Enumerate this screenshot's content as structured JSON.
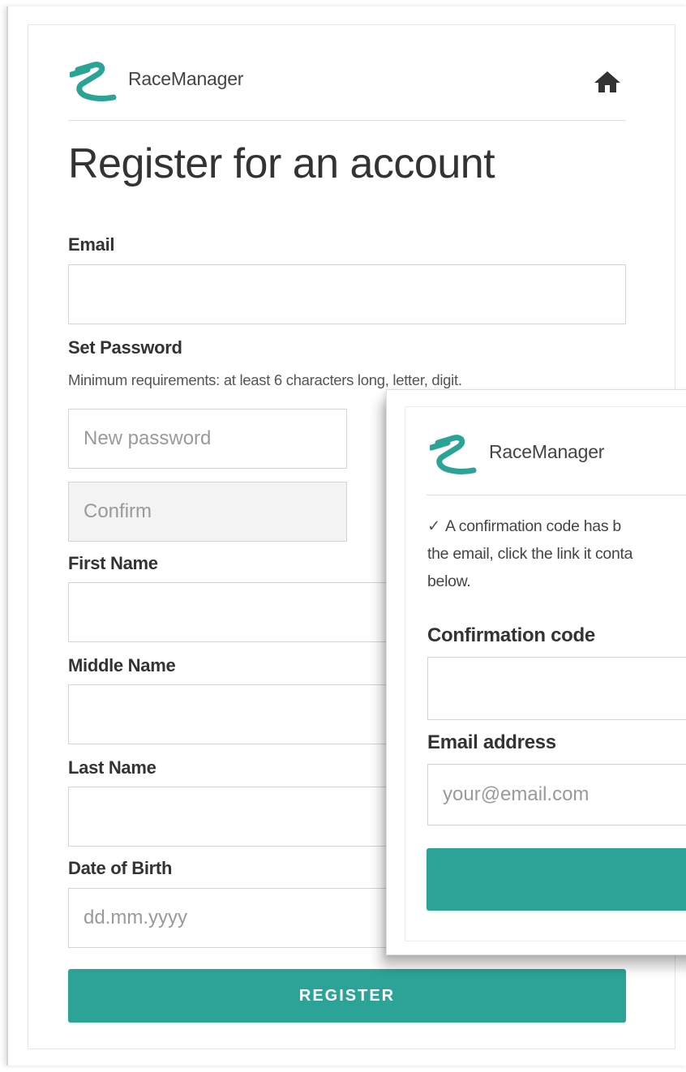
{
  "brand": {
    "name": "RaceManager",
    "accent_color": "#2ba396",
    "logo": "racemanager-r-logo"
  },
  "header": {
    "home_icon": "home-icon"
  },
  "page": {
    "title": "Register for an account"
  },
  "form": {
    "email": {
      "label": "Email",
      "value": ""
    },
    "password": {
      "label": "Set Password",
      "hint": "Minimum requirements: at least 6 characters long, letter, digit.",
      "new_placeholder": "New password",
      "confirm_placeholder": "Confirm"
    },
    "first_name": {
      "label": "First Name",
      "value": ""
    },
    "middle_name": {
      "label": "Middle Name",
      "value": ""
    },
    "last_name": {
      "label": "Last Name",
      "value": ""
    },
    "dob": {
      "label": "Date of Birth",
      "placeholder": "dd.mm.yyyy"
    },
    "submit_label": "REGISTER"
  },
  "popup": {
    "brand_name": "RaceManager",
    "message_line1": "A confirmation code has b",
    "message_line2": "the email, click the link it conta",
    "message_line3": "below.",
    "check_icon": "checkmark-icon",
    "code_label": "Confirmation code",
    "code_value": "",
    "email_label": "Email address",
    "email_placeholder": "your@email.com",
    "submit_label": ""
  }
}
